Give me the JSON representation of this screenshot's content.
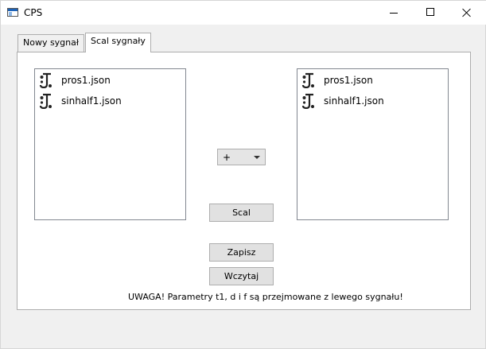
{
  "window": {
    "title": "CPS",
    "icon": "app-window-icon",
    "controls": [
      "minimize-icon",
      "maximize-icon",
      "close-icon"
    ]
  },
  "tabs": [
    {
      "label": "Nowy sygnał",
      "active": false
    },
    {
      "label": "Scal sygnały",
      "active": true
    }
  ],
  "left_list": {
    "items": [
      {
        "label": "pros1.json",
        "icon": "signal-file-icon"
      },
      {
        "label": "sinhalf1.json",
        "icon": "signal-file-icon"
      }
    ]
  },
  "right_list": {
    "items": [
      {
        "label": "pros1.json",
        "icon": "signal-file-icon"
      },
      {
        "label": "sinhalf1.json",
        "icon": "signal-file-icon"
      }
    ]
  },
  "operation_select": {
    "value": "+"
  },
  "buttons": {
    "merge": "Scal",
    "save": "Zapisz",
    "load": "Wczytaj"
  },
  "warning": "UWAGA! Parametry t1, d i f są przejmowane z lewego sygnału!"
}
